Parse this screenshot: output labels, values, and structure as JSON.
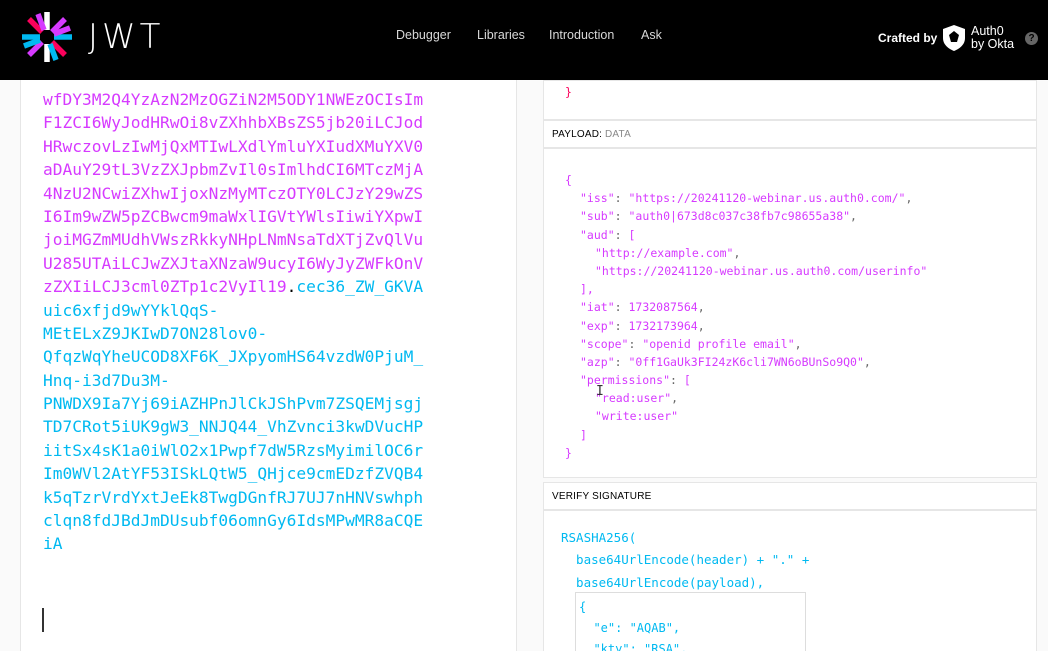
{
  "header": {
    "logo_text": "JWT",
    "nav": [
      {
        "label": "Debugger"
      },
      {
        "label": "Libraries"
      },
      {
        "label": "Introduction"
      },
      {
        "label": "Ask"
      }
    ],
    "crafted_by": "Crafted by",
    "brand_line1": "Auth0",
    "brand_line2": "by Okta",
    "help": "?"
  },
  "encoded": {
    "lines": [
      {
        "text": "wfDY3M2Q4YzAzN2MzOGZiN2M5ODY1NWEzOCIsIm",
        "part": "payload"
      },
      {
        "text": "F1ZCI6WyJodHRwOi8vZXhhbXBsZS5jb20iLCJod",
        "part": "payload"
      },
      {
        "text": "HRwczovLzIwMjQxMTIwLXdlYmluYXIudXMuYXV0",
        "part": "payload"
      },
      {
        "text": "aDAuY29tL3VzZXJpbmZvIl0sImlhdCI6MTczMjA",
        "part": "payload"
      },
      {
        "text": "4NzU2NCwiZXhwIjoxNzMyMTczOTY0LCJzY29wZS",
        "part": "payload"
      },
      {
        "text": "I6Im9wZW5pZCBwcm9maWxlIGVtYWlsIiwiYXpwI",
        "part": "payload"
      },
      {
        "text": "joiMGZmMUdhVWszRkkyNHpLNmNsaTdXTjZvQlVu",
        "part": "payload"
      },
      {
        "text": "U285UTAiLCJwZXJtaXNzaW9ucyI6WyJyZWFkOnV",
        "part": "payload"
      },
      {
        "text": "zZXIiLCJ3cml0ZTp1c2VyIl19",
        "part": "payload",
        "dot": ".",
        "tail": "cec36_ZW_GKVA"
      },
      {
        "text": "uic6xfjd9wYYklQqS-",
        "part": "signature"
      },
      {
        "text": "MEtELxZ9JKIwD7ON28lov0-",
        "part": "signature"
      },
      {
        "text": "QfqzWqYheUCOD8XF6K_JXpyomHS64vzdW0PjuM_",
        "part": "signature"
      },
      {
        "text": "Hnq-i3d7Du3M-",
        "part": "signature"
      },
      {
        "text": "PNWDX9Ia7Yj69iAZHPnJlCkJShPvm7ZSQEMjsgj",
        "part": "signature"
      },
      {
        "text": "TD7CRot5iUK9gW3_NNJQ44_VhZvnci3kwDVucHP",
        "part": "signature"
      },
      {
        "text": "iitSx4sK1a0iWlO2x1Pwpf7dW5RzsMyimilOC6r",
        "part": "signature"
      },
      {
        "text": "Im0WVl2AtYF53ISkLQtW5_QHjce9cmEDzfZVQB4",
        "part": "signature"
      },
      {
        "text": "k5qTzrVrdYxtJeEk8TwgDGnfRJ7UJ7nHNVswhph",
        "part": "signature"
      },
      {
        "text": "clqn8fdJBdJmDUsubf06omnGy6IdsMPwMR8aCQE",
        "part": "signature"
      },
      {
        "text": "iA",
        "part": "signature"
      }
    ]
  },
  "header_tail": "}",
  "payload": {
    "title": "PAYLOAD:",
    "subtitle": "DATA",
    "lines": [
      {
        "indent": 0,
        "punct": "{"
      },
      {
        "indent": 1,
        "key": "\"iss\"",
        "sep": ": ",
        "val": "\"https://20241120-webinar.us.auth0.com/\"",
        "end": ","
      },
      {
        "indent": 1,
        "key": "\"sub\"",
        "sep": ": ",
        "val": "\"auth0|673d8c037c38fb7c98655a38\"",
        "end": ","
      },
      {
        "indent": 1,
        "key": "\"aud\"",
        "sep": ": ",
        "val": "",
        "end": "["
      },
      {
        "indent": 2,
        "val": "\"http://example.com\"",
        "end": ","
      },
      {
        "indent": 2,
        "val": "\"https://20241120-webinar.us.auth0.com/userinfo\"",
        "end": ""
      },
      {
        "indent": 1,
        "punct": "],"
      },
      {
        "indent": 1,
        "key": "\"iat\"",
        "sep": ": ",
        "val": "1732087564",
        "end": ","
      },
      {
        "indent": 1,
        "key": "\"exp\"",
        "sep": ": ",
        "val": "1732173964",
        "end": ","
      },
      {
        "indent": 1,
        "key": "\"scope\"",
        "sep": ": ",
        "val": "\"openid profile email\"",
        "end": ","
      },
      {
        "indent": 1,
        "key": "\"azp\"",
        "sep": ": ",
        "val": "\"0ff1GaUk3FI24zK6cli7WN6oBUnSo9Q0\"",
        "end": ","
      },
      {
        "indent": 1,
        "key": "\"permissions\"",
        "sep": ": ",
        "val": "",
        "end": "["
      },
      {
        "indent": 2,
        "val": "\"read:user\"",
        "end": ","
      },
      {
        "indent": 2,
        "val": "\"write:user\"",
        "end": ""
      },
      {
        "indent": 1,
        "punct": "]"
      },
      {
        "indent": 0,
        "punct": "}"
      }
    ]
  },
  "verify": {
    "title": "VERIFY SIGNATURE",
    "code_lines": [
      "RSASHA256(",
      "  base64UrlEncode(header) + \".\" +",
      "  base64UrlEncode(payload),"
    ],
    "key_lines": [
      "{",
      "  \"e\": \"AQAB\",",
      "  \"kty\": \"RSA\","
    ]
  },
  "colors": {
    "payload": "#d63aff",
    "signature": "#00b9f1",
    "header_bg": "#000000"
  }
}
